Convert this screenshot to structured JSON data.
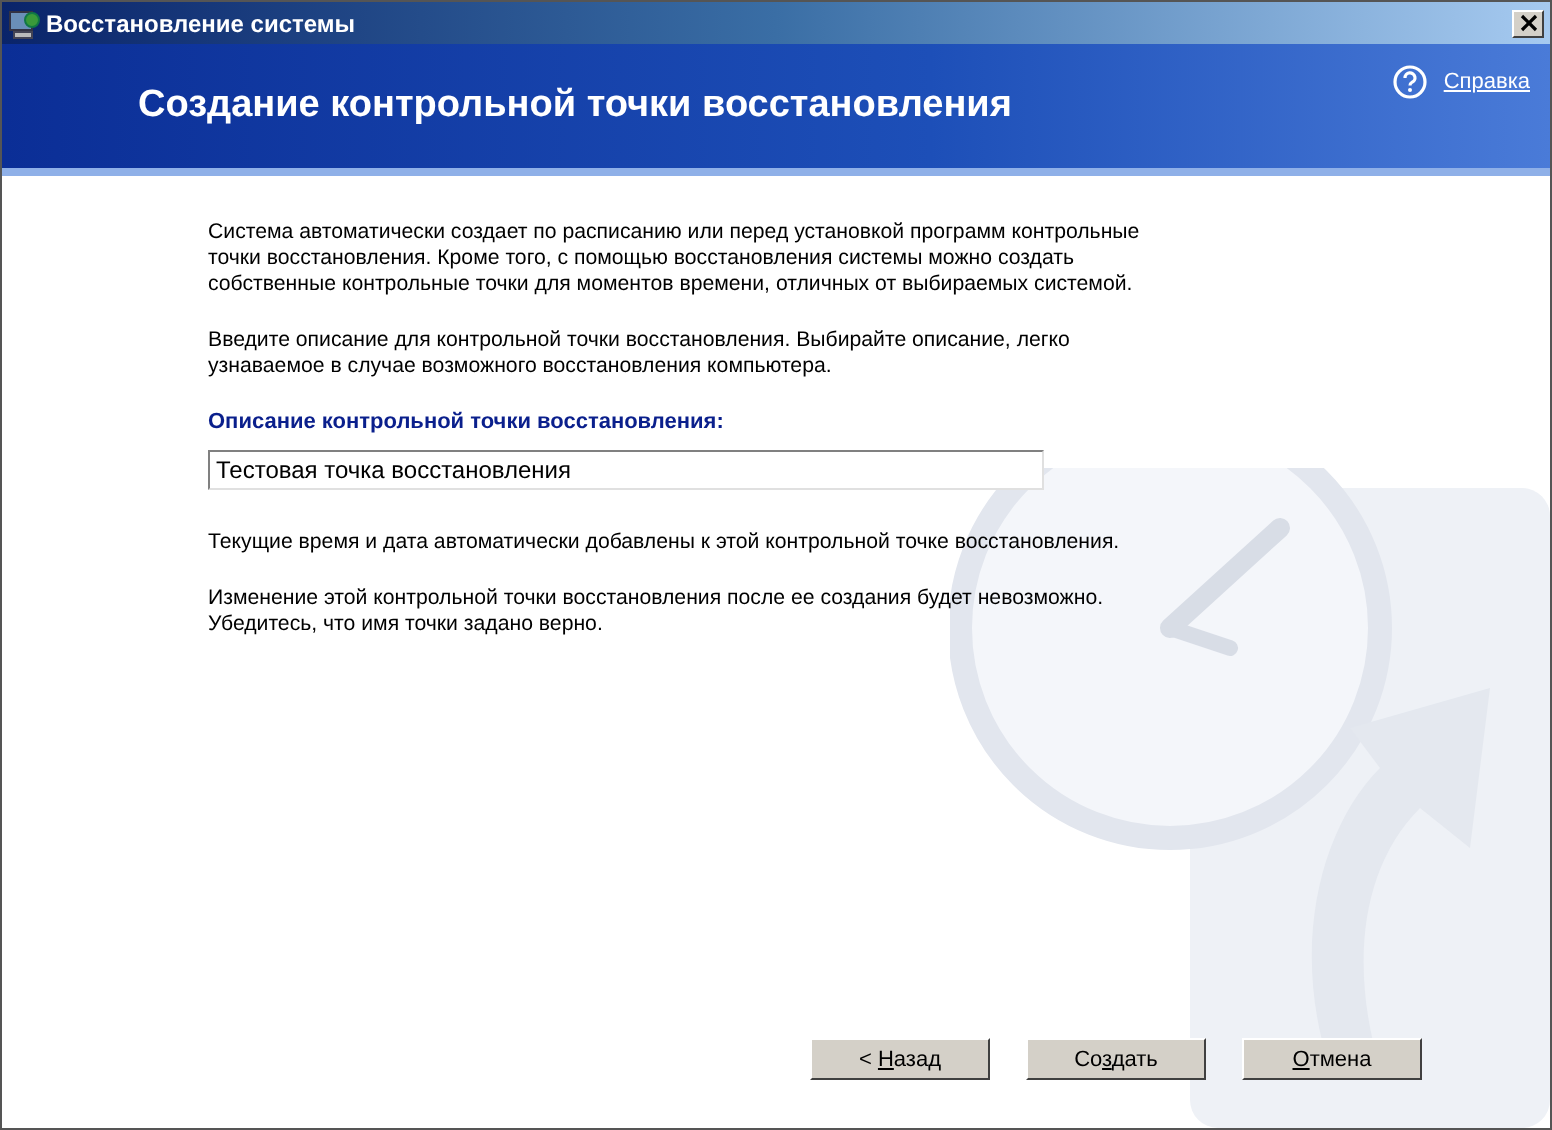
{
  "window": {
    "title": "Восстановление системы"
  },
  "header": {
    "title": "Создание контрольной точки восстановления",
    "help_link": "Справка"
  },
  "intro": [
    "Система автоматически создает по расписанию или перед установкой программ контрольные точки восстановления. Кроме того, с помощью восстановления системы можно создать собственные контрольные точки для моментов времени, отличных от выбираемых системой.",
    "Введите описание для контрольной точки восстановления. Выбирайте описание, легко узнаваемое в случае возможного восстановления компьютера."
  ],
  "description_field": {
    "label": "Описание контрольной точки восстановления:",
    "value": "Тестовая точка восстановления"
  },
  "notes": [
    "Текущие время и дата автоматически добавлены к этой контрольной точке восстановления.",
    "Изменение этой контрольной точки восстановления после ее создания будет невозможно. Убедитесь, что имя точки задано верно."
  ],
  "buttons": [
    {
      "before": "< ",
      "key": "Н",
      "after": "азад"
    },
    {
      "before": "Со",
      "key": "з",
      "after": "дать"
    },
    {
      "key": "О",
      "after": "тмена"
    }
  ]
}
